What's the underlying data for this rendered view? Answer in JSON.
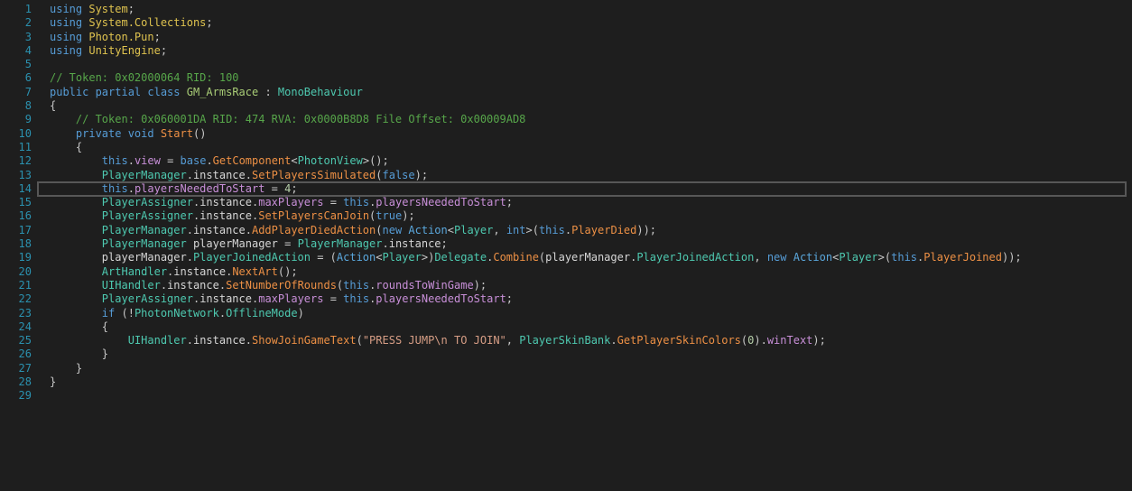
{
  "editor": {
    "language": "csharp-decompiled",
    "current_line": 14,
    "colors": {
      "background": "#1e1e1e",
      "line_number": "#2b91af",
      "current_line_border": "#575757",
      "keyword": "#569cd6",
      "namespace": "#dfc34f",
      "comment": "#57a64a",
      "type": "#4ec9b0",
      "type_declaration": "#a8cc76",
      "delegate": "#5aa7dc",
      "method": "#ed9045",
      "field": "#c88fd8",
      "number": "#b5cea8",
      "string": "#d69d85",
      "punctuation": "#c8c8c8",
      "identifier": "#d6d6d6"
    },
    "lines": [
      {
        "n": 1,
        "tokens": [
          [
            "k",
            "using"
          ],
          [
            "ns",
            " System"
          ],
          [
            "p",
            ";"
          ]
        ]
      },
      {
        "n": 2,
        "tokens": [
          [
            "k",
            "using"
          ],
          [
            "ns",
            " System.Collections"
          ],
          [
            "p",
            ";"
          ]
        ]
      },
      {
        "n": 3,
        "tokens": [
          [
            "k",
            "using"
          ],
          [
            "ns",
            " Photon.Pun"
          ],
          [
            "p",
            ";"
          ]
        ]
      },
      {
        "n": 4,
        "tokens": [
          [
            "k",
            "using"
          ],
          [
            "ns",
            " UnityEngine"
          ],
          [
            "p",
            ";"
          ]
        ]
      },
      {
        "n": 5,
        "tokens": []
      },
      {
        "n": 6,
        "tokens": [
          [
            "c",
            "// Token: 0x02000064 RID: 100"
          ]
        ]
      },
      {
        "n": 7,
        "tokens": [
          [
            "k",
            "public"
          ],
          [
            "k",
            " partial"
          ],
          [
            "k",
            " class"
          ],
          [
            "ty2",
            " GM_ArmsRace"
          ],
          [
            "p",
            " :"
          ],
          [
            "ty",
            " MonoBehaviour"
          ]
        ]
      },
      {
        "n": 8,
        "tokens": [
          [
            "p",
            "{"
          ]
        ]
      },
      {
        "n": 9,
        "tokens": [
          [
            "c",
            "    // Token: 0x060001DA RID: 474 RVA: 0x0000B8D8 File Offset: 0x00009AD8"
          ]
        ]
      },
      {
        "n": 10,
        "tokens": [
          [
            "p",
            "    "
          ],
          [
            "k",
            "private"
          ],
          [
            "k",
            " void"
          ],
          [
            "m",
            " Start"
          ],
          [
            "p",
            "()"
          ]
        ]
      },
      {
        "n": 11,
        "tokens": [
          [
            "p",
            "    {"
          ]
        ]
      },
      {
        "n": 12,
        "tokens": [
          [
            "p",
            "        "
          ],
          [
            "k",
            "this"
          ],
          [
            "p",
            "."
          ],
          [
            "f",
            "view"
          ],
          [
            "p",
            " = "
          ],
          [
            "k",
            "base"
          ],
          [
            "p",
            "."
          ],
          [
            "m",
            "GetComponent"
          ],
          [
            "p",
            "<"
          ],
          [
            "ty",
            "PhotonView"
          ],
          [
            "p",
            ">();"
          ]
        ]
      },
      {
        "n": 13,
        "tokens": [
          [
            "p",
            "        "
          ],
          [
            "ty",
            "PlayerManager"
          ],
          [
            "p",
            "."
          ],
          [
            "v",
            "instance"
          ],
          [
            "p",
            "."
          ],
          [
            "m",
            "SetPlayersSimulated"
          ],
          [
            "p",
            "("
          ],
          [
            "k",
            "false"
          ],
          [
            "p",
            ");"
          ]
        ]
      },
      {
        "n": 14,
        "tokens": [
          [
            "p",
            "        "
          ],
          [
            "k",
            "this"
          ],
          [
            "p",
            "."
          ],
          [
            "f",
            "playersNeededToStart"
          ],
          [
            "p",
            " = "
          ],
          [
            "num",
            "4"
          ],
          [
            "p",
            ";"
          ]
        ]
      },
      {
        "n": 15,
        "tokens": [
          [
            "p",
            "        "
          ],
          [
            "ty",
            "PlayerAssigner"
          ],
          [
            "p",
            "."
          ],
          [
            "v",
            "instance"
          ],
          [
            "p",
            "."
          ],
          [
            "f",
            "maxPlayers"
          ],
          [
            "p",
            " = "
          ],
          [
            "k",
            "this"
          ],
          [
            "p",
            "."
          ],
          [
            "f",
            "playersNeededToStart"
          ],
          [
            "p",
            ";"
          ]
        ]
      },
      {
        "n": 16,
        "tokens": [
          [
            "p",
            "        "
          ],
          [
            "ty",
            "PlayerAssigner"
          ],
          [
            "p",
            "."
          ],
          [
            "v",
            "instance"
          ],
          [
            "p",
            "."
          ],
          [
            "m",
            "SetPlayersCanJoin"
          ],
          [
            "p",
            "("
          ],
          [
            "k",
            "true"
          ],
          [
            "p",
            ");"
          ]
        ]
      },
      {
        "n": 17,
        "tokens": [
          [
            "p",
            "        "
          ],
          [
            "ty",
            "PlayerManager"
          ],
          [
            "p",
            "."
          ],
          [
            "v",
            "instance"
          ],
          [
            "p",
            "."
          ],
          [
            "m",
            "AddPlayerDiedAction"
          ],
          [
            "p",
            "("
          ],
          [
            "k",
            "new"
          ],
          [
            "dg",
            " Action"
          ],
          [
            "p",
            "<"
          ],
          [
            "ty",
            "Player"
          ],
          [
            "p",
            ", "
          ],
          [
            "k",
            "int"
          ],
          [
            "p",
            ">("
          ],
          [
            "k",
            "this"
          ],
          [
            "p",
            "."
          ],
          [
            "m",
            "PlayerDied"
          ],
          [
            "p",
            "));"
          ]
        ]
      },
      {
        "n": 18,
        "tokens": [
          [
            "p",
            "        "
          ],
          [
            "ty",
            "PlayerManager"
          ],
          [
            "v",
            " playerManager"
          ],
          [
            "p",
            " = "
          ],
          [
            "ty",
            "PlayerManager"
          ],
          [
            "p",
            "."
          ],
          [
            "v",
            "instance"
          ],
          [
            "p",
            ";"
          ]
        ]
      },
      {
        "n": 19,
        "tokens": [
          [
            "p",
            "        "
          ],
          [
            "v",
            "playerManager"
          ],
          [
            "p",
            "."
          ],
          [
            "ty",
            "PlayerJoinedAction"
          ],
          [
            "p",
            " = ("
          ],
          [
            "dg",
            "Action"
          ],
          [
            "p",
            "<"
          ],
          [
            "ty",
            "Player"
          ],
          [
            "p",
            ">)"
          ],
          [
            "ty",
            "Delegate"
          ],
          [
            "p",
            "."
          ],
          [
            "m",
            "Combine"
          ],
          [
            "p",
            "("
          ],
          [
            "v",
            "playerManager"
          ],
          [
            "p",
            "."
          ],
          [
            "ty",
            "PlayerJoinedAction"
          ],
          [
            "p",
            ", "
          ],
          [
            "k",
            "new"
          ],
          [
            "dg",
            " Action"
          ],
          [
            "p",
            "<"
          ],
          [
            "ty",
            "Player"
          ],
          [
            "p",
            ">("
          ],
          [
            "k",
            "this"
          ],
          [
            "p",
            "."
          ],
          [
            "m",
            "PlayerJoined"
          ],
          [
            "p",
            "));"
          ]
        ]
      },
      {
        "n": 20,
        "tokens": [
          [
            "p",
            "        "
          ],
          [
            "ty",
            "ArtHandler"
          ],
          [
            "p",
            "."
          ],
          [
            "v",
            "instance"
          ],
          [
            "p",
            "."
          ],
          [
            "m",
            "NextArt"
          ],
          [
            "p",
            "();"
          ]
        ]
      },
      {
        "n": 21,
        "tokens": [
          [
            "p",
            "        "
          ],
          [
            "ty",
            "UIHandler"
          ],
          [
            "p",
            "."
          ],
          [
            "v",
            "instance"
          ],
          [
            "p",
            "."
          ],
          [
            "m",
            "SetNumberOfRounds"
          ],
          [
            "p",
            "("
          ],
          [
            "k",
            "this"
          ],
          [
            "p",
            "."
          ],
          [
            "f",
            "roundsToWinGame"
          ],
          [
            "p",
            ");"
          ]
        ]
      },
      {
        "n": 22,
        "tokens": [
          [
            "p",
            "        "
          ],
          [
            "ty",
            "PlayerAssigner"
          ],
          [
            "p",
            "."
          ],
          [
            "v",
            "instance"
          ],
          [
            "p",
            "."
          ],
          [
            "f",
            "maxPlayers"
          ],
          [
            "p",
            " = "
          ],
          [
            "k",
            "this"
          ],
          [
            "p",
            "."
          ],
          [
            "f",
            "playersNeededToStart"
          ],
          [
            "p",
            ";"
          ]
        ]
      },
      {
        "n": 23,
        "tokens": [
          [
            "p",
            "        "
          ],
          [
            "k",
            "if"
          ],
          [
            "p",
            " (!"
          ],
          [
            "ty",
            "PhotonNetwork"
          ],
          [
            "p",
            "."
          ],
          [
            "ty",
            "OfflineMode"
          ],
          [
            "p",
            ")"
          ]
        ]
      },
      {
        "n": 24,
        "tokens": [
          [
            "p",
            "        {"
          ]
        ]
      },
      {
        "n": 25,
        "tokens": [
          [
            "p",
            "            "
          ],
          [
            "ty",
            "UIHandler"
          ],
          [
            "p",
            "."
          ],
          [
            "v",
            "instance"
          ],
          [
            "p",
            "."
          ],
          [
            "m",
            "ShowJoinGameText"
          ],
          [
            "p",
            "("
          ],
          [
            "str",
            "\"PRESS JUMP\\n TO JOIN\""
          ],
          [
            "p",
            ", "
          ],
          [
            "ty",
            "PlayerSkinBank"
          ],
          [
            "p",
            "."
          ],
          [
            "m",
            "GetPlayerSkinColors"
          ],
          [
            "p",
            "("
          ],
          [
            "num",
            "0"
          ],
          [
            "p",
            ")."
          ],
          [
            "f",
            "winText"
          ],
          [
            "p",
            ");"
          ]
        ]
      },
      {
        "n": 26,
        "tokens": [
          [
            "p",
            "        }"
          ]
        ]
      },
      {
        "n": 27,
        "tokens": [
          [
            "p",
            "    }"
          ]
        ]
      },
      {
        "n": 28,
        "tokens": [
          [
            "p",
            "}"
          ]
        ]
      },
      {
        "n": 29,
        "tokens": []
      }
    ]
  }
}
